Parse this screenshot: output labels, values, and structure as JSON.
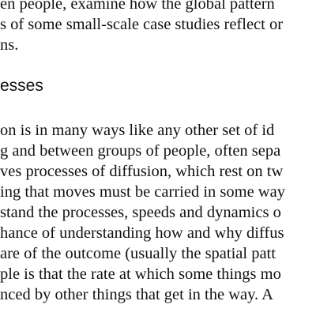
{
  "intro_paragraph": {
    "lines": [
      "en people, examine how the global pattern",
      "s of some small-scale case studies reflect or",
      "ns."
    ]
  },
  "section_heading": "esses",
  "body_paragraph": {
    "lines": [
      "on is in many ways like any other set of id",
      "g and between groups of people, often sepa",
      "ves processes of diffusion, which rest on tw",
      "ing that moves must be carried in some way",
      "stand the processes, speeds and dynamics o",
      "hance of understanding how and why diffus",
      "are of the outcome (usually the spatial patt",
      "ple is that the rate at which some things mo",
      "nced by other things that get in the way. A"
    ]
  }
}
